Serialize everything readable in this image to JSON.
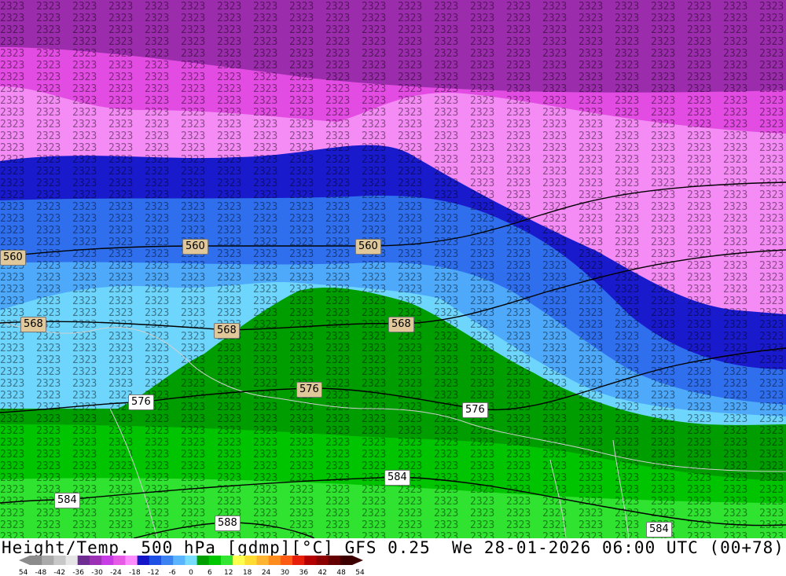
{
  "map": {
    "title_left": "Height/Temp. 500 hPa [gdmp][°C] GFS 0.25",
    "title_right": "We 28-01-2026 06:00 UTC (00+78)",
    "contour_labels": [
      {
        "text": "560",
        "bg": "#e0c89a"
      },
      {
        "text": "560",
        "bg": "#e0c89a"
      },
      {
        "text": "560",
        "bg": "#e0c89a"
      },
      {
        "text": "568",
        "bg": "#e0c89a"
      },
      {
        "text": "568",
        "bg": "#e0c89a"
      },
      {
        "text": "568",
        "bg": "#e0c89a"
      },
      {
        "text": "576",
        "bg": "#e0c89a"
      },
      {
        "text": "576",
        "bg": "#ffffff"
      },
      {
        "text": "576",
        "bg": "#ffffff"
      },
      {
        "text": "584",
        "bg": "#ffffff"
      },
      {
        "text": "584",
        "bg": "#ffffff"
      },
      {
        "text": "584",
        "bg": "#ffffff"
      },
      {
        "text": "588",
        "bg": "#ffffff"
      }
    ],
    "colorbar": {
      "ticks": [
        "-54",
        "-48",
        "-42",
        "-36",
        "-30",
        "-24",
        "-18",
        "-12",
        "-6",
        "0",
        "6",
        "12",
        "18",
        "24",
        "30",
        "36",
        "42",
        "48",
        "54"
      ],
      "colors": [
        "#8c8c8c",
        "#aaaaaa",
        "#c8c8c8",
        "#e6e6e6",
        "#6e2d91",
        "#9b30b4",
        "#c83ce6",
        "#e65ae6",
        "#ff8cff",
        "#1414c8",
        "#1e50e6",
        "#3c82f0",
        "#5ab4ff",
        "#78dcff",
        "#00a000",
        "#00c800",
        "#32e632",
        "#ffff50",
        "#ffdc32",
        "#ffb432",
        "#ff8c1e",
        "#ff5a14",
        "#e61e0a",
        "#b40000",
        "#8c0000",
        "#640000",
        "#3c0000"
      ]
    },
    "legend_icon": "colorbar-triangle-arrows"
  }
}
